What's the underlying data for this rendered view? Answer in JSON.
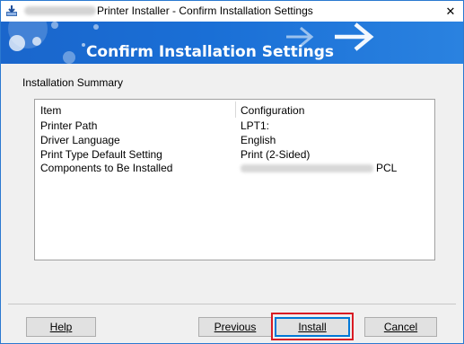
{
  "window": {
    "title": "Printer Installer - Confirm Installation Settings",
    "close_glyph": "✕"
  },
  "banner": {
    "title": "Confirm Installation Settings"
  },
  "summary": {
    "section_label": "Installation Summary",
    "headers": {
      "item": "Item",
      "configuration": "Configuration"
    },
    "rows": [
      {
        "item": "Printer Path",
        "value": "LPT1:"
      },
      {
        "item": "Driver Language",
        "value": "English"
      },
      {
        "item": "Print Type Default Setting",
        "value": "Print (2-Sided)"
      },
      {
        "item": "Components to Be Installed",
        "value": "PCL"
      }
    ]
  },
  "buttons": {
    "help": "Help",
    "previous": "Previous",
    "install": "Install",
    "cancel": "Cancel"
  },
  "colors": {
    "banner_blue": "#1a6fd6",
    "window_border": "#2b79d0",
    "highlight_red": "#d91c24",
    "default_button_blue": "#0078d7"
  },
  "icons": {
    "app": "download-installer-icon",
    "close": "close-icon",
    "banner_arrows": "arrow-right-icon"
  }
}
